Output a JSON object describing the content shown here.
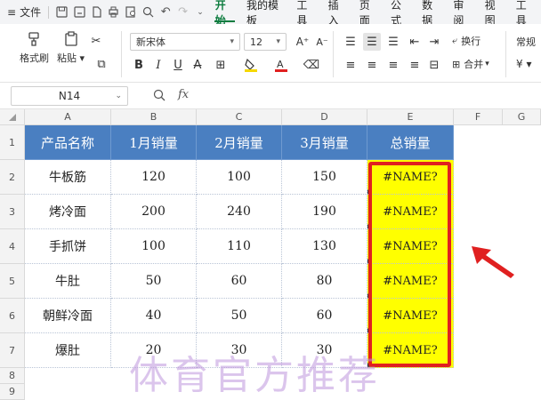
{
  "menubar": {
    "menu_icon": "≡",
    "file_label": "文件",
    "tabs": [
      "开始",
      "我的模板",
      "工具",
      "插入",
      "页面",
      "公式",
      "数据",
      "审阅",
      "视图",
      "工具"
    ],
    "active_tab": "开始"
  },
  "ribbon": {
    "format_painter": "格式刷",
    "paste": "粘贴",
    "font_name": "新宋体",
    "font_size": "12",
    "wrap_text": "换行",
    "merge": "合并",
    "number_format": "常规"
  },
  "formula_bar": {
    "cell_ref": "N14",
    "fx": "fx",
    "content": ""
  },
  "columns": [
    "A",
    "B",
    "C",
    "D",
    "E",
    "F",
    "G"
  ],
  "rows": [
    "1",
    "2",
    "3",
    "4",
    "5",
    "6",
    "7",
    "8",
    "9"
  ],
  "table": {
    "headers": [
      "产品名称",
      "1月销量",
      "2月销量",
      "3月销量",
      "总销量"
    ],
    "rows": [
      [
        "牛板筋",
        "120",
        "100",
        "150",
        "#NAME?"
      ],
      [
        "烤冷面",
        "200",
        "240",
        "190",
        "#NAME?"
      ],
      [
        "手抓饼",
        "100",
        "110",
        "130",
        "#NAME?"
      ],
      [
        "牛肚",
        "50",
        "60",
        "80",
        "#NAME?"
      ],
      [
        "朝鲜冷面",
        "40",
        "50",
        "60",
        "#NAME?"
      ],
      [
        "爆肚",
        "20",
        "30",
        "30",
        "#NAME?"
      ]
    ]
  },
  "colors": {
    "header_bg": "#4a7fc1",
    "error_bg": "#ffff00",
    "highlight": "#e02020",
    "accent": "#0d7c3f"
  },
  "watermark": "体育官方推荐"
}
